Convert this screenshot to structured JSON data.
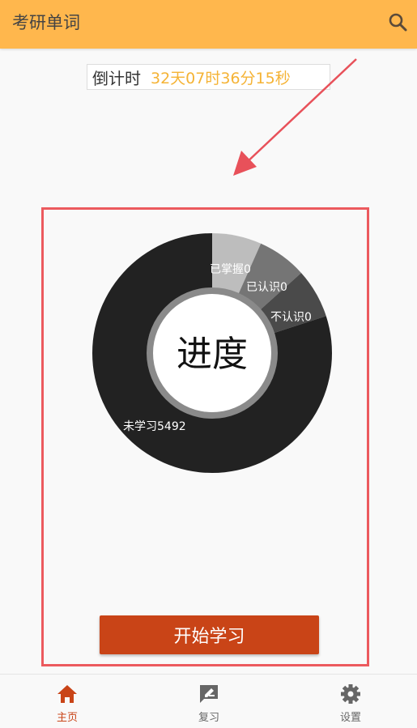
{
  "app_bar": {
    "title": "考研单词",
    "search_icon": "search-icon"
  },
  "countdown": {
    "label": "倒计时",
    "value": "32天07时36分15秒"
  },
  "progress": {
    "center_text": "进度",
    "segments": [
      {
        "name": "已掌握",
        "count": 0,
        "label": "已掌握0",
        "color": "#bdbdbd"
      },
      {
        "name": "已认识",
        "count": 0,
        "label": "已认识0",
        "color": "#757575"
      },
      {
        "name": "不认识",
        "count": 0,
        "label": "不认识0",
        "color": "#4a4a4a"
      },
      {
        "name": "未学习",
        "count": 5492,
        "label": "未学习5492",
        "color": "#222222"
      }
    ]
  },
  "start_button": {
    "label": "开始学习"
  },
  "bottom_nav": {
    "items": [
      {
        "label": "主页",
        "icon": "home-icon",
        "active": true
      },
      {
        "label": "复习",
        "icon": "review-icon",
        "active": false
      },
      {
        "label": "设置",
        "icon": "gear-icon",
        "active": false
      }
    ]
  },
  "colors": {
    "app_bar": "#ffb74d",
    "countdown_value": "#f5b335",
    "accent": "#c94417",
    "panel_border": "#ec5a5e"
  }
}
